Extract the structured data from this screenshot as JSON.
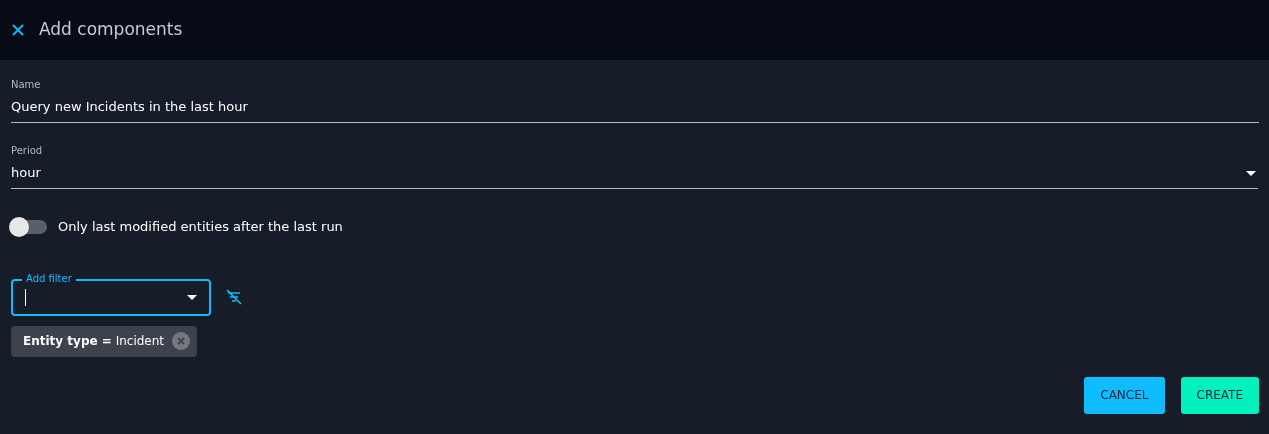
{
  "header": {
    "title": "Add components"
  },
  "name_field": {
    "label": "Name",
    "value": "Query new Incidents in the last hour"
  },
  "period_field": {
    "label": "Period",
    "value": "hour"
  },
  "toggle": {
    "label": "Only last modified entities after the last run",
    "on": false
  },
  "filter_field": {
    "label": "Add filter",
    "focused": true
  },
  "filters": [
    {
      "text": "**Entity type =** Incident"
    }
  ],
  "buttons": [
    {
      "label": "CANCEL",
      "kind": "secondary"
    },
    {
      "label": "CREATE",
      "kind": "primary"
    }
  ]
}
